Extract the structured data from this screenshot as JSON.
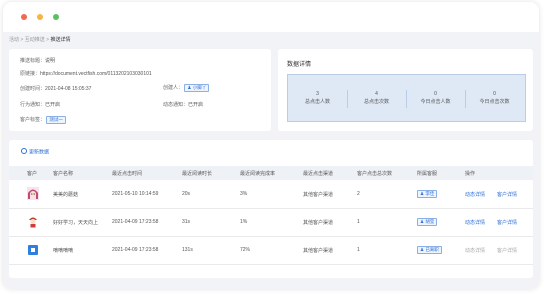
{
  "breadcrumb": {
    "items": [
      "活动",
      "互动推送"
    ],
    "current": "推送详情"
  },
  "info": {
    "id_label": "推送标题：",
    "id_value": "说明",
    "link_label": "原链接：",
    "link_value": "https://document.vectfish.com/0113202103030101",
    "created_label": "创建时间：",
    "created_value": "2021-04-08 15:05:37",
    "creator_label": "创建人：",
    "creator_value": "小脚丫",
    "behavior_label": "行为通知：",
    "behavior_value": "已开启",
    "dynamic_label": "动态通知：",
    "dynamic_value": "已开启",
    "tag_label": "客户标签：",
    "tag_value": "测试一"
  },
  "detail": {
    "title": "数据详情",
    "stats": [
      {
        "num": "3",
        "label": "总点击人数"
      },
      {
        "num": "4",
        "label": "总点击次数"
      },
      {
        "num": "0",
        "label": "今日点击人数"
      },
      {
        "num": "0",
        "label": "今日点击次数"
      }
    ]
  },
  "table": {
    "refresh_label": "更新数据",
    "headers": [
      "客户",
      "客户名称",
      "最近点击时间",
      "最近阅读时长",
      "最近阅读完成率",
      "最近点击渠道",
      "客户点击总次数",
      "所属客服",
      "操作"
    ],
    "rows": [
      {
        "name": "美美的蘑菇",
        "time": "2021-05-10 10:14:59",
        "duration": "20s",
        "rate": "3%",
        "channel": "其他客户渠道",
        "clicks": "2",
        "owner": "李佳",
        "action1": "动态详情",
        "action2": "客户详情",
        "avatar": "anime-girl-avatar"
      },
      {
        "name": "好好学习，天天向上",
        "time": "2021-04-09 17:23:58",
        "duration": "31s",
        "rate": "1%",
        "channel": "其他客户渠道",
        "clicks": "1",
        "owner": "胡莹",
        "action1": "动态详情",
        "action2": "客户详情",
        "avatar": "cartoon-kid-avatar"
      },
      {
        "name": "嘀嘀嘀嘀",
        "time": "2021-04-09 17:23:58",
        "duration": "131s",
        "rate": "72%",
        "channel": "其他客户渠道",
        "clicks": "1",
        "owner": "已离职",
        "action1": "动态详情",
        "action2": "客户详情",
        "avatar": "blue-square-avatar"
      }
    ]
  },
  "colors": {
    "accent": "#2f6fd6",
    "stat_bg": "#dfe9f6",
    "window_bg": "#f2f3f6"
  }
}
